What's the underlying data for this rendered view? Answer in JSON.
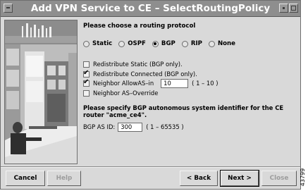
{
  "window": {
    "title": "Add VPN Service to CE – SelectRoutingPolicy"
  },
  "prompt": {
    "heading": "Please choose a routing protocol"
  },
  "protocols": [
    {
      "label": "Static",
      "selected": false
    },
    {
      "label": "OSPF",
      "selected": false
    },
    {
      "label": "BGP",
      "selected": true
    },
    {
      "label": "RIP",
      "selected": false
    },
    {
      "label": "None",
      "selected": false
    }
  ],
  "options": {
    "redistribute_static": {
      "label": "Redistribute Static (BGP only).",
      "checked": false
    },
    "redistribute_connected": {
      "label": "Redistribute Connected (BGP only).",
      "checked": true
    },
    "neighbor_allowas": {
      "label": "Neighbor AllowAS–in",
      "checked": true,
      "value": "10",
      "range": "( 1 – 10 )"
    },
    "neighbor_override": {
      "label": "Neighbor AS–Override",
      "checked": false
    }
  },
  "bgp": {
    "instruction": "Please specify BGP autonomous system identifier for the CE router \"acme_ce4\".",
    "as_id_label": "BGP AS ID:",
    "as_id_value": "300",
    "as_id_range": "( 1 – 65535 )"
  },
  "buttons": {
    "cancel": "Cancel",
    "help": "Help",
    "back": "< Back",
    "next": "Next >",
    "close": "Close"
  },
  "figure_id": "43799",
  "colors": {
    "titlebar": "#8e8e8e",
    "dialog_bg": "#d9d9d9",
    "disabled_text": "#9c9c9c"
  }
}
